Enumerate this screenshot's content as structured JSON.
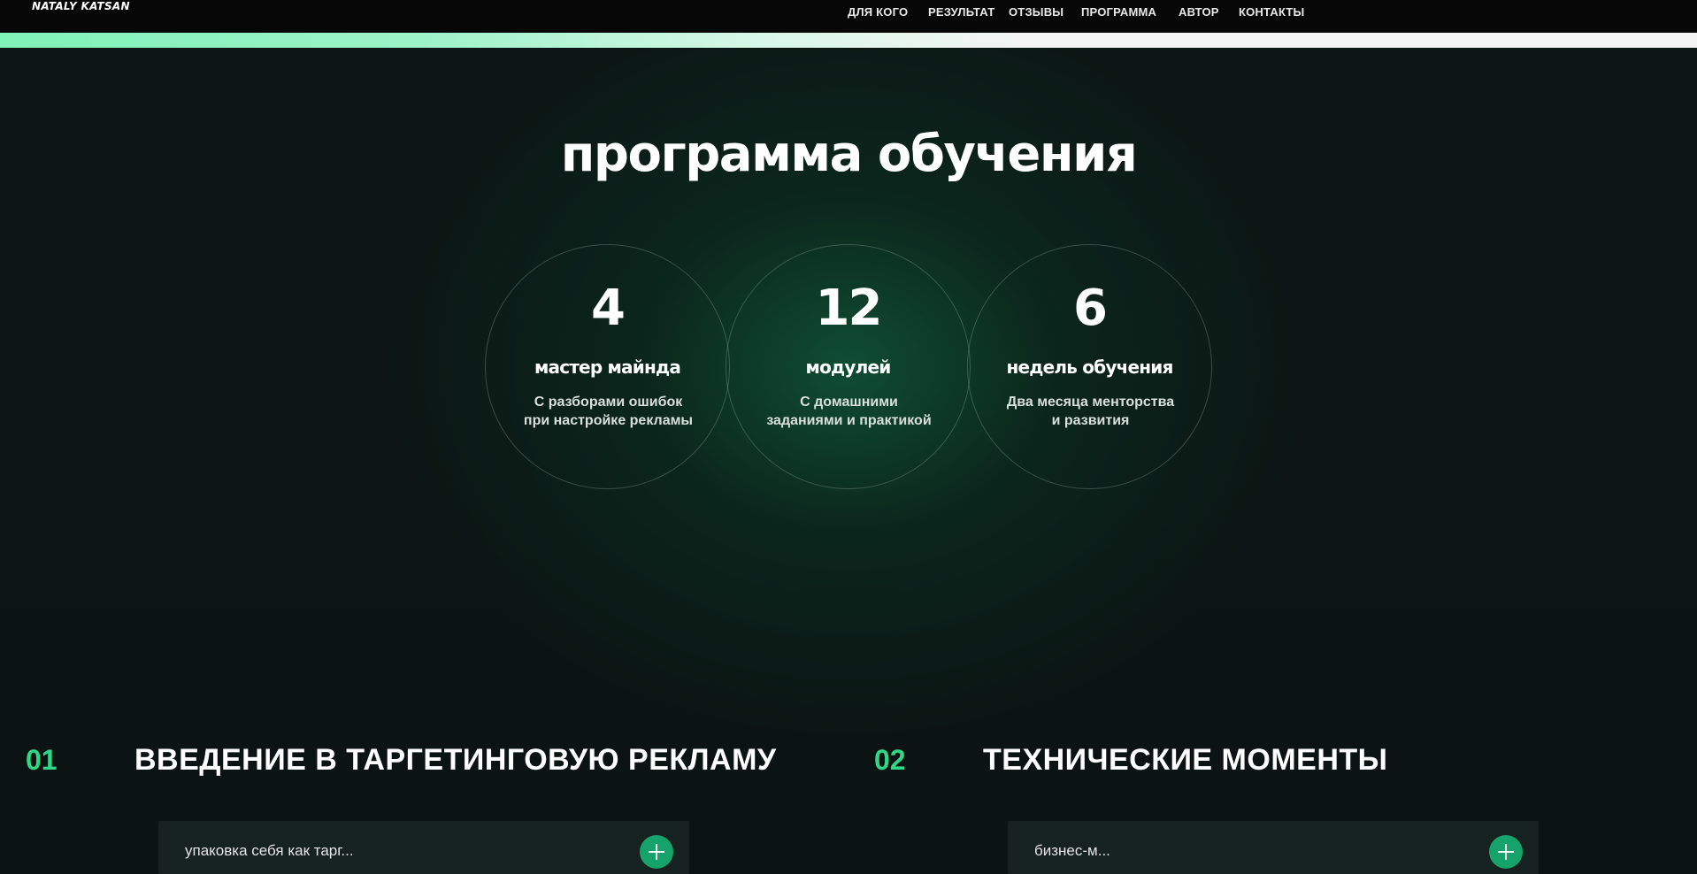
{
  "header": {
    "logo": "NATALY KATSAN",
    "nav": [
      {
        "label": "ДЛЯ КОГО"
      },
      {
        "label": "РЕЗУЛЬТАТ"
      },
      {
        "label": "ОТЗЫВЫ"
      },
      {
        "label": "ПРОГРАММА"
      },
      {
        "label": "АВТОР"
      },
      {
        "label": "КОНТАКТЫ"
      }
    ]
  },
  "scroll_progress": {
    "value_percent": 45,
    "fill_color": "#7ff2b8",
    "track_color": "#f4f4f4"
  },
  "program": {
    "title": "программа обучения",
    "stats": [
      {
        "number": "4",
        "title": "мастер майнда",
        "desc_line1": "С разборами ошибок",
        "desc_line2": "при настройке рекламы"
      },
      {
        "number": "12",
        "title": "модулей",
        "desc_line1": "С домашними",
        "desc_line2": "заданиями и практикой"
      },
      {
        "number": "6",
        "title": "недель обучения",
        "desc_line1": "Два месяца менторства",
        "desc_line2": "и развития"
      }
    ]
  },
  "modules": [
    {
      "num": "01",
      "title": "ВВЕДЕНИЕ В ТАРГЕТИНГОВУЮ РЕКЛАМУ",
      "first_item": "упаковка себя как тарг...",
      "expand_icon": "plus-icon"
    },
    {
      "num": "02",
      "title": "ТЕХНИЧЕСКИЕ МОМЕНТЫ",
      "first_item": "бизнес-м...",
      "expand_icon": "plus-icon"
    }
  ],
  "colors": {
    "accent": "#2fd886",
    "background": "#0b1412",
    "button": "#15a26b"
  }
}
